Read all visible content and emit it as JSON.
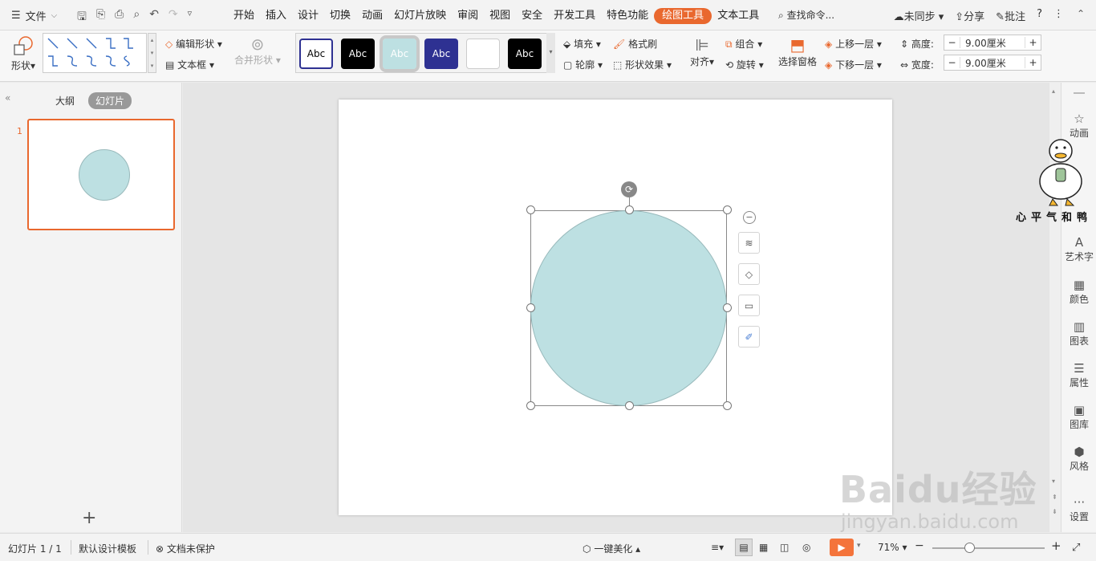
{
  "topbar": {
    "file_label": "文件",
    "tabs": [
      "开始",
      "插入",
      "设计",
      "切换",
      "动画",
      "幻灯片放映",
      "审阅",
      "视图",
      "安全",
      "开发工具",
      "特色功能",
      "绘图工具",
      "文本工具"
    ],
    "active_tab": "绘图工具",
    "search_label": "查找命令...",
    "sync_label": "未同步",
    "share_label": "分享",
    "comment_label": "批注"
  },
  "ribbon": {
    "shape_label": "形状",
    "edit_shape_label": "编辑形状",
    "textbox_label": "文本框",
    "merge_shape_label": "合并形状",
    "style_samples": [
      "Abc",
      "Abc",
      "Abc",
      "Abc",
      "Abc",
      "Abc"
    ],
    "fill_label": "填充",
    "format_painter_label": "格式刷",
    "outline_label": "轮廓",
    "shape_effect_label": "形状效果",
    "align_label": "对齐",
    "group_label": "组合",
    "rotate_label": "旋转",
    "selection_pane_label": "选择窗格",
    "bring_forward_label": "上移一层",
    "send_backward_label": "下移一层",
    "height_label": "高度:",
    "height_value": "9.00厘米",
    "width_label": "宽度:",
    "width_value": "9.00厘米"
  },
  "left_panel": {
    "outline_tab": "大纲",
    "slides_tab": "幻灯片",
    "slide_number": "1"
  },
  "shape": {
    "fill_color": "#bde0e2",
    "type": "circle"
  },
  "side_panel": {
    "items": [
      "动画",
      "艺术字",
      "颜色",
      "图表",
      "属性",
      "图库",
      "风格",
      "设置"
    ]
  },
  "status": {
    "slide_info": "幻灯片 1 / 1",
    "template": "默认设计模板",
    "protect": "文档未保护",
    "beautify": "一键美化",
    "zoom": "71%"
  },
  "watermark": {
    "brand": "Baidu经验",
    "url": "jingyan.baidu.com",
    "sticker_text": "心平气和鸭"
  },
  "colors": {
    "accent": "#e9682e",
    "play": "#f4743b"
  }
}
